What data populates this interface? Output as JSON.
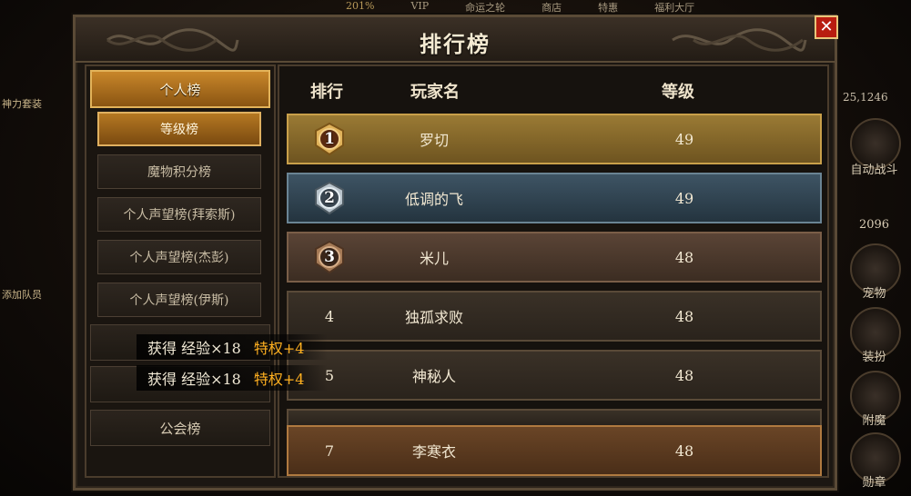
{
  "top_bar": [
    "VIP",
    "命运之轮",
    "商店",
    "特惠",
    "福利大厅"
  ],
  "top_bar_percent": "201%",
  "left_strip": {
    "suit_label": "神力套装",
    "add_team": "添加队员"
  },
  "coord": "25,1246",
  "right_strip": {
    "auto_battle": "自动战斗",
    "power": "2096",
    "pet": "宠物",
    "dress": "装扮",
    "enchant": "附魔",
    "medal": "勋章"
  },
  "panel": {
    "title": "排行榜",
    "close": "✕"
  },
  "nav": {
    "main": "个人榜",
    "items": [
      "等级榜",
      "魔物积分榜",
      "个人声望榜(拜索斯)",
      "个人声望榜(杰彭)",
      "个人声望榜(伊斯)"
    ],
    "group_guild": "公会榜"
  },
  "table": {
    "headers": {
      "rank": "排行",
      "name": "玩家名",
      "level": "等级"
    },
    "rows": [
      {
        "rank": "1",
        "name": "罗切",
        "level": "49"
      },
      {
        "rank": "2",
        "name": "低调的飞",
        "level": "49"
      },
      {
        "rank": "3",
        "name": "米儿",
        "level": "48"
      },
      {
        "rank": "4",
        "name": "独孤求败",
        "level": "48"
      },
      {
        "rank": "5",
        "name": "神秘人",
        "level": "48"
      },
      {
        "rank": "7",
        "name": "李寒衣",
        "level": "48"
      }
    ]
  },
  "toasts": [
    {
      "gain": "获得 经验×18",
      "priv": "特权+4"
    },
    {
      "gain": "获得 经验×18",
      "priv": "特权+4"
    }
  ],
  "colors": {
    "gold": "#c9a04a",
    "silver": "#6a8494",
    "bronze": "#7a5e48",
    "accent": "#ffb020",
    "close": "#b81d10"
  }
}
